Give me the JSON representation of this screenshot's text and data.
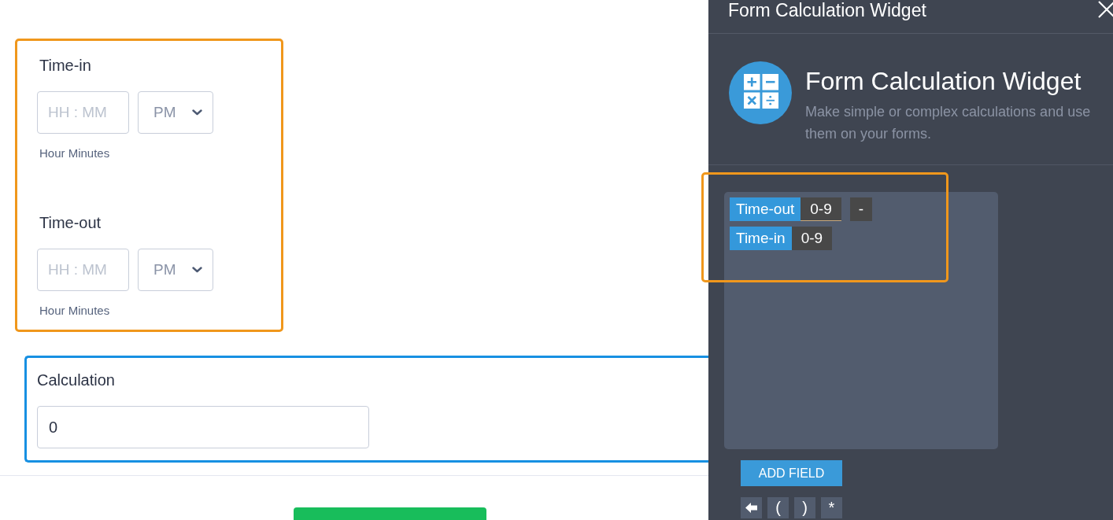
{
  "form": {
    "time_group": {
      "highlighted": true,
      "fields": [
        {
          "label": "Time-in",
          "placeholder": "HH : MM",
          "period": "PM",
          "sublabel": "Hour Minutes"
        },
        {
          "label": "Time-out",
          "placeholder": "HH : MM",
          "period": "PM",
          "sublabel": "Hour Minutes"
        }
      ]
    },
    "calculation": {
      "label": "Calculation",
      "value": "0",
      "selected": true
    }
  },
  "widget_panel": {
    "title": "Form Calculation Widget",
    "heading": "Form Calculation Widget",
    "description": "Make simple or complex calculations and use them on your forms.",
    "formula": {
      "highlighted": true,
      "rows": [
        [
          {
            "kind": "field",
            "text": "Time-out",
            "focused": false
          },
          {
            "kind": "range",
            "text": "0-9",
            "focused": true
          },
          {
            "kind": "operator",
            "text": "-",
            "focused": false
          }
        ],
        [
          {
            "kind": "field",
            "text": "Time-in",
            "focused": false
          },
          {
            "kind": "range",
            "text": "0-9",
            "focused": false
          }
        ]
      ]
    },
    "add_field_button": "ADD FIELD",
    "keys": [
      {
        "kind": "backspace"
      },
      {
        "kind": "symbol",
        "text": "("
      },
      {
        "kind": "symbol",
        "text": ")"
      },
      {
        "kind": "symbol",
        "text": "*"
      }
    ]
  }
}
